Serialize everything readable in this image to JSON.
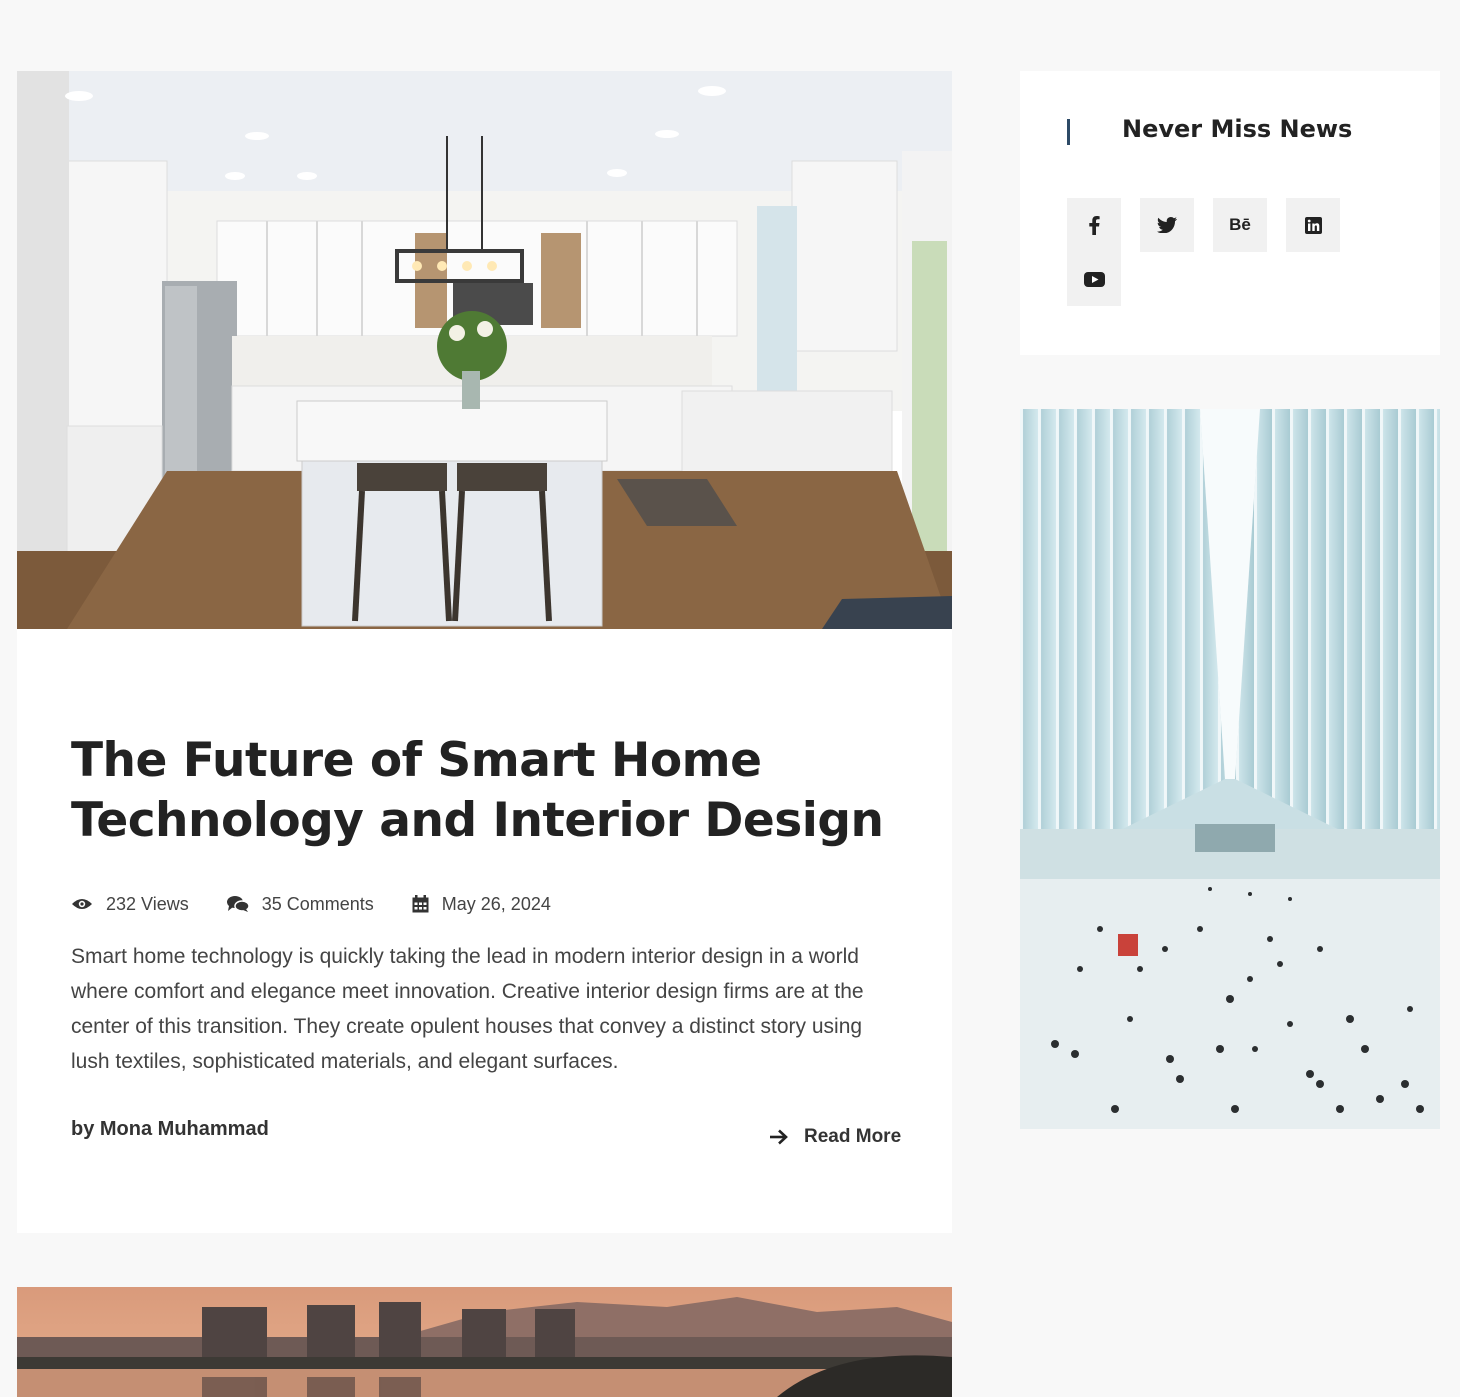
{
  "post": {
    "image_alt": "kitchen-interior-photo",
    "title": "The Future of Smart Home Technology and Interior Design",
    "meta": {
      "views": "232 Views",
      "comments": "35 Comments",
      "date": "May 26, 2024"
    },
    "excerpt": "Smart home technology is quickly taking the lead in modern interior design in a world where comfort and elegance meet innovation. Creative interior design firms are at the center of this transition. They create opulent houses that convey a distinct story using lush textiles, sophisticated materials, and elegant surfaces.",
    "author": "by Mona Muhammad",
    "read_more": "Read More"
  },
  "sidebar": {
    "widget_title": "Never Miss News",
    "social": [
      {
        "icon": "facebook-icon"
      },
      {
        "icon": "twitter-icon"
      },
      {
        "icon": "behance-icon",
        "label": "Bē"
      },
      {
        "icon": "linkedin-icon"
      },
      {
        "icon": "youtube-icon"
      }
    ]
  },
  "colors": {
    "accent_bar": "#2d4a66",
    "background": "#f8f8f8",
    "social_bg": "#f1f1f1"
  }
}
